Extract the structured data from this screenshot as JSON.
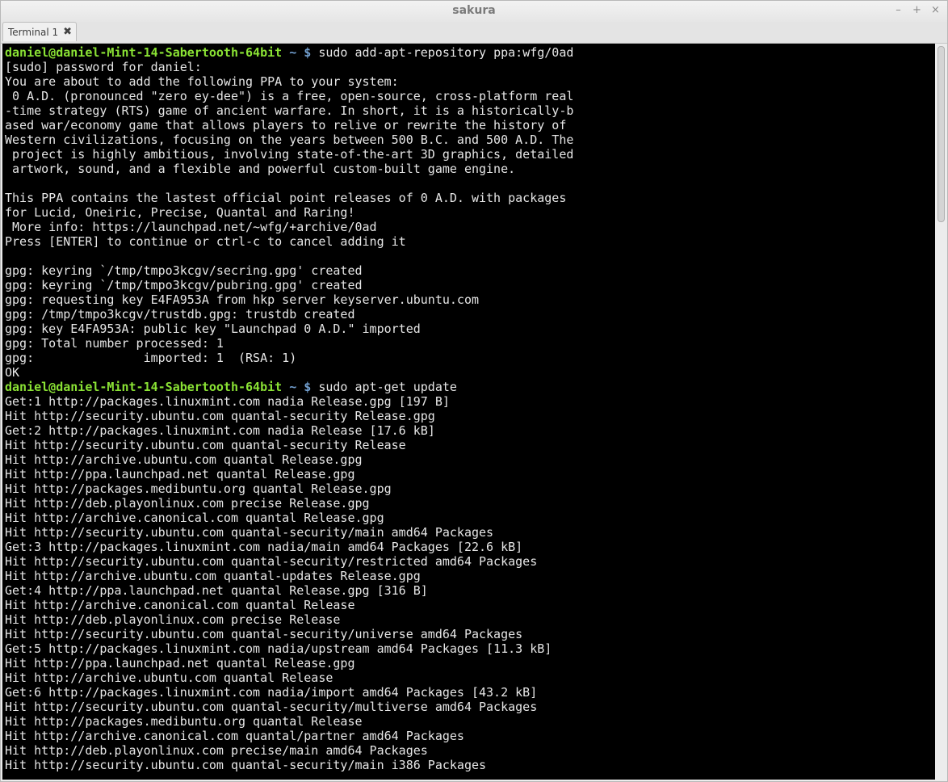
{
  "window": {
    "title": "sakura",
    "controls": [
      "–",
      "+",
      "×"
    ]
  },
  "tabs": [
    {
      "label": "Terminal 1",
      "close": "✖"
    }
  ],
  "colors": {
    "terminal_bg": "#000000",
    "terminal_fg": "#e6e6e6",
    "prompt_user": "#8ae234",
    "prompt_path": "#729fcf"
  },
  "terminal": {
    "lines": [
      {
        "kind": "prompt",
        "user": "daniel@daniel-Mint-14-Sabertooth-64bit",
        "path": "~ $",
        "cmd": " sudo add-apt-repository ppa:wfg/0ad"
      },
      {
        "kind": "text",
        "text": "[sudo] password for daniel:"
      },
      {
        "kind": "text",
        "text": "You are about to add the following PPA to your system:"
      },
      {
        "kind": "text",
        "text": " 0 A.D. (pronounced \"zero ey-dee\") is a free, open-source, cross-platform real"
      },
      {
        "kind": "text",
        "text": "-time strategy (RTS) game of ancient warfare. In short, it is a historically-b"
      },
      {
        "kind": "text",
        "text": "ased war/economy game that allows players to relive or rewrite the history of"
      },
      {
        "kind": "text",
        "text": "Western civilizations, focusing on the years between 500 B.C. and 500 A.D. The"
      },
      {
        "kind": "text",
        "text": " project is highly ambitious, involving state-of-the-art 3D graphics, detailed"
      },
      {
        "kind": "text",
        "text": " artwork, sound, and a flexible and powerful custom-built game engine."
      },
      {
        "kind": "text",
        "text": ""
      },
      {
        "kind": "text",
        "text": "This PPA contains the lastest official point releases of 0 A.D. with packages"
      },
      {
        "kind": "text",
        "text": "for Lucid, Oneiric, Precise, Quantal and Raring!"
      },
      {
        "kind": "text",
        "text": " More info: https://launchpad.net/~wfg/+archive/0ad"
      },
      {
        "kind": "text",
        "text": "Press [ENTER] to continue or ctrl-c to cancel adding it"
      },
      {
        "kind": "text",
        "text": ""
      },
      {
        "kind": "text",
        "text": "gpg: keyring `/tmp/tmpo3kcgv/secring.gpg' created"
      },
      {
        "kind": "text",
        "text": "gpg: keyring `/tmp/tmpo3kcgv/pubring.gpg' created"
      },
      {
        "kind": "text",
        "text": "gpg: requesting key E4FA953A from hkp server keyserver.ubuntu.com"
      },
      {
        "kind": "text",
        "text": "gpg: /tmp/tmpo3kcgv/trustdb.gpg: trustdb created"
      },
      {
        "kind": "text",
        "text": "gpg: key E4FA953A: public key \"Launchpad 0 A.D.\" imported"
      },
      {
        "kind": "text",
        "text": "gpg: Total number processed: 1"
      },
      {
        "kind": "text",
        "text": "gpg:               imported: 1  (RSA: 1)"
      },
      {
        "kind": "text",
        "text": "OK"
      },
      {
        "kind": "prompt",
        "user": "daniel@daniel-Mint-14-Sabertooth-64bit",
        "path": "~ $",
        "cmd": " sudo apt-get update"
      },
      {
        "kind": "text",
        "text": "Get:1 http://packages.linuxmint.com nadia Release.gpg [197 B]"
      },
      {
        "kind": "text",
        "text": "Hit http://security.ubuntu.com quantal-security Release.gpg"
      },
      {
        "kind": "text",
        "text": "Get:2 http://packages.linuxmint.com nadia Release [17.6 kB]"
      },
      {
        "kind": "text",
        "text": "Hit http://security.ubuntu.com quantal-security Release"
      },
      {
        "kind": "text",
        "text": "Hit http://archive.ubuntu.com quantal Release.gpg"
      },
      {
        "kind": "text",
        "text": "Hit http://ppa.launchpad.net quantal Release.gpg"
      },
      {
        "kind": "text",
        "text": "Hit http://packages.medibuntu.org quantal Release.gpg"
      },
      {
        "kind": "text",
        "text": "Hit http://deb.playonlinux.com precise Release.gpg"
      },
      {
        "kind": "text",
        "text": "Hit http://archive.canonical.com quantal Release.gpg"
      },
      {
        "kind": "text",
        "text": "Hit http://security.ubuntu.com quantal-security/main amd64 Packages"
      },
      {
        "kind": "text",
        "text": "Get:3 http://packages.linuxmint.com nadia/main amd64 Packages [22.6 kB]"
      },
      {
        "kind": "text",
        "text": "Hit http://security.ubuntu.com quantal-security/restricted amd64 Packages"
      },
      {
        "kind": "text",
        "text": "Hit http://archive.ubuntu.com quantal-updates Release.gpg"
      },
      {
        "kind": "text",
        "text": "Get:4 http://ppa.launchpad.net quantal Release.gpg [316 B]"
      },
      {
        "kind": "text",
        "text": "Hit http://archive.canonical.com quantal Release"
      },
      {
        "kind": "text",
        "text": "Hit http://deb.playonlinux.com precise Release"
      },
      {
        "kind": "text",
        "text": "Hit http://security.ubuntu.com quantal-security/universe amd64 Packages"
      },
      {
        "kind": "text",
        "text": "Get:5 http://packages.linuxmint.com nadia/upstream amd64 Packages [11.3 kB]"
      },
      {
        "kind": "text",
        "text": "Hit http://ppa.launchpad.net quantal Release.gpg"
      },
      {
        "kind": "text",
        "text": "Hit http://archive.ubuntu.com quantal Release"
      },
      {
        "kind": "text",
        "text": "Get:6 http://packages.linuxmint.com nadia/import amd64 Packages [43.2 kB]"
      },
      {
        "kind": "text",
        "text": "Hit http://security.ubuntu.com quantal-security/multiverse amd64 Packages"
      },
      {
        "kind": "text",
        "text": "Hit http://packages.medibuntu.org quantal Release"
      },
      {
        "kind": "text",
        "text": "Hit http://archive.canonical.com quantal/partner amd64 Packages"
      },
      {
        "kind": "text",
        "text": "Hit http://deb.playonlinux.com precise/main amd64 Packages"
      },
      {
        "kind": "text",
        "text": "Hit http://security.ubuntu.com quantal-security/main i386 Packages"
      }
    ]
  }
}
